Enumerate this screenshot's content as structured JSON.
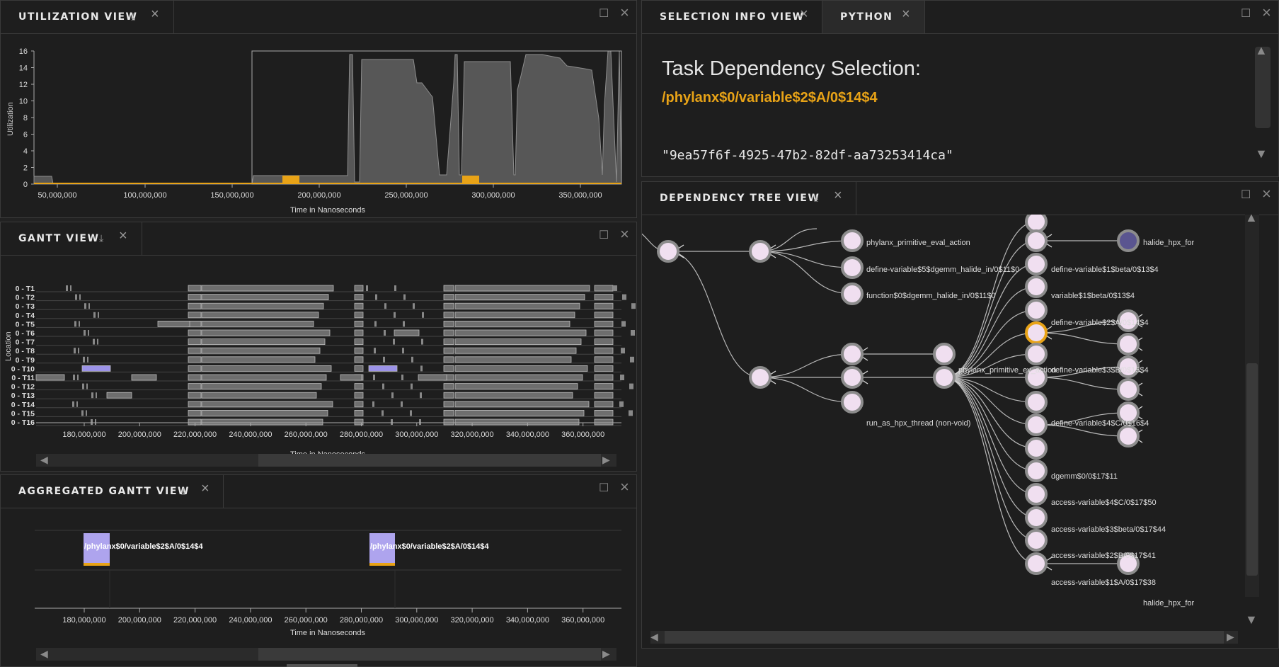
{
  "colors": {
    "accent": "#e8a317",
    "highlight": "#9c93e8",
    "bar_fill": "#6e6e6e",
    "node_fill": "#f0dff0"
  },
  "utilization": {
    "tab": "UTILIZATION VIEW",
    "ylabel": "Utilization",
    "xlabel": "Time in Nanoseconds",
    "yticks": [
      "16",
      "14",
      "12",
      "10",
      "8",
      "6",
      "4",
      "2",
      "0"
    ],
    "xticks": [
      "50,000,000",
      "100,000,000",
      "150,000,000",
      "200,000,000",
      "250,000,000",
      "300,000,000",
      "350,000,000"
    ]
  },
  "gantt": {
    "tab": "GANTT VIEW",
    "ylabel": "Location",
    "xlabel": "Time in Nanoseconds",
    "rows": [
      "0 - T1",
      "0 - T2",
      "0 - T3",
      "0 - T4",
      "0 - T5",
      "0 - T6",
      "0 - T7",
      "0 - T8",
      "0 - T9",
      "0 - T10",
      "0 - T11",
      "0 - T12",
      "0 - T13",
      "0 - T14",
      "0 - T15",
      "0 - T16"
    ],
    "xticks": [
      "180,000,000",
      "200,000,000",
      "220,000,000",
      "240,000,000",
      "260,000,000",
      "280,000,000",
      "300,000,000",
      "320,000,000",
      "340,000,000",
      "360,000,000"
    ]
  },
  "aggregated": {
    "tab": "AGGREGATED GANTT VIEW",
    "xlabel": "Time in Nanoseconds",
    "label1": "/phylanx$0/variable$2$A/0$14$4",
    "label2": "/phylanx$0/variable$2$A/0$14$4",
    "xticks": [
      "180,000,000",
      "200,000,000",
      "220,000,000",
      "240,000,000",
      "260,000,000",
      "280,000,000",
      "300,000,000",
      "320,000,000",
      "340,000,000",
      "360,000,000"
    ]
  },
  "selection": {
    "tab1": "SELECTION INFO VIEW",
    "tab2": "PYTHON",
    "title": "Task Dependency Selection:",
    "path": "/phylanx$0/variable$2$A/0$14$4",
    "id": "\"9ea57f6f-4925-47b2-82df-aa73253414ca\""
  },
  "tree": {
    "tab": "DEPENDENCY TREE VIEW",
    "labels": [
      "phylanx_primitive_eval_action",
      "define-variable$5$dgemm_halide_in/0$11$0",
      "function$0$dgemm_halide_in/0$11$0",
      "phylanx_primitive_ev_action",
      "run_as_hpx_thread (non-void)",
      "halide_hpx_for",
      "define-variable$1$beta/0$13$4",
      "variable$1$beta/0$13$4",
      "define-variable$2$A/0$14$4",
      "define-variable$3$B/0$15$4",
      "define-variable$4$C/0$16$4",
      "dgemm$0/0$17$11",
      "access-variable$4$C/0$17$50",
      "access-variable$3$beta/0$17$44",
      "access-variable$2$B/0$17$41",
      "access-variable$1$A/0$17$38",
      "halide_hpx_for"
    ]
  },
  "icons": {
    "download": "download-icon",
    "close": "close-icon",
    "maximize": "maximize-icon"
  }
}
